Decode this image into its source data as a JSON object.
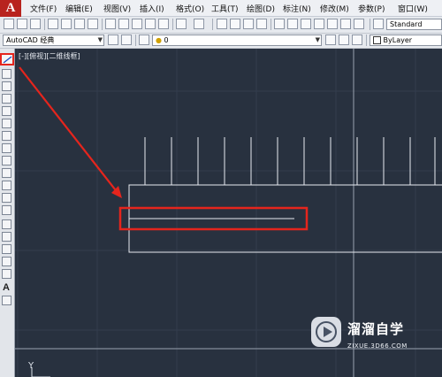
{
  "menubar": {
    "items": [
      "文件(F)",
      "编辑(E)",
      "视图(V)",
      "插入(I)",
      "格式(O)",
      "工具(T)",
      "绘图(D)",
      "标注(N)",
      "修改(M)",
      "参数(P)",
      "窗口(W)"
    ]
  },
  "toolbar1": {
    "text_style": "Standard"
  },
  "toolbar2": {
    "workspace": "AutoCAD 经典",
    "layer": "0",
    "color": "ByLayer"
  },
  "viewport": {
    "label": "[-][俯视][二维线框]"
  },
  "palette": {
    "text_tool_glyph": "A"
  },
  "ucs": {
    "y_label": "Y"
  },
  "watermark": {
    "title": "溜溜自学",
    "subtitle": "ZIXUE.3D66.COM"
  },
  "colors": {
    "canvas": "#28313f",
    "highlight": "#e5251d",
    "app_logo": "#b8231e"
  },
  "icons": [
    "line-tool-icon",
    "polyline-icon",
    "circle-icon",
    "arc-icon",
    "rectangle-icon",
    "hatch-icon",
    "text-icon",
    "watermark-play-icon"
  ]
}
